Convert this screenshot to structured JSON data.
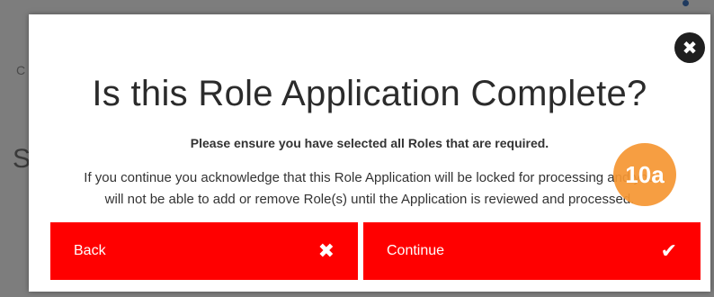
{
  "background": {
    "partial_text_1": "C",
    "partial_text_2": "S"
  },
  "modal": {
    "close_icon": "close-icon",
    "title": "Is this Role Application Complete?",
    "subtitle": "Please ensure you have selected all Roles that are required.",
    "body_line_1": "If you continue you acknowledge that this Role Application will be locked for processing and you",
    "body_line_2": "will not be able to add or remove Role(s) until the Application is reviewed and processed.",
    "badge": "10a",
    "back_label": "Back",
    "back_icon": "x-icon",
    "continue_label": "Continue",
    "continue_icon": "checkmark-icon"
  },
  "colors": {
    "accent": "#ff0000",
    "badge": "#f5963 2",
    "close_bg": "#1f1f1f"
  }
}
